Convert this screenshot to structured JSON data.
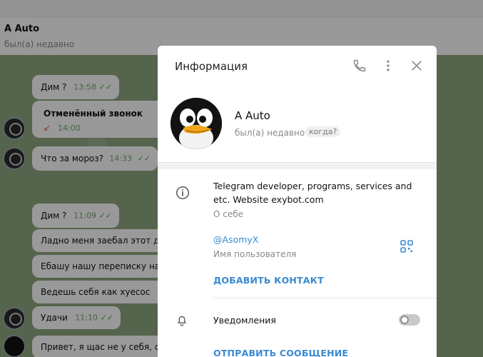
{
  "chat": {
    "title": "A Auto",
    "status": "был(а) недавно",
    "messages": [
      {
        "text": "Дим ?",
        "time": "13:58",
        "ticks": "✓✓"
      },
      {
        "text": "Отменённый звонок",
        "time": "14:00",
        "ticks": ""
      },
      {
        "text": "Что за мороз?",
        "time": "14:33",
        "ticks": "✓✓"
      },
      {
        "text": "Дим ?",
        "time": "11:09",
        "ticks": "✓✓"
      },
      {
        "text": "Ладно меня заебал этот др",
        "time": "",
        "ticks": ""
      },
      {
        "text": "Ебашу нашу переписку на",
        "time": "",
        "ticks": ""
      },
      {
        "text": "Ведешь себя как хуесос",
        "time": "",
        "ticks": ""
      },
      {
        "text": "Удачи",
        "time": "11:10",
        "ticks": "✓✓"
      },
      {
        "text": "Привет, я щас не у себя, св",
        "time": "",
        "ticks": ""
      }
    ]
  },
  "modal": {
    "title": "Информация",
    "icons": {
      "call": "phone-icon",
      "more": "more-vertical-icon",
      "close": "close-icon"
    },
    "profile": {
      "name": "A Auto",
      "status": "был(а) недавно",
      "when_chip": "когда?"
    },
    "bio": {
      "text": "Telegram developer, programs, services and etc. Website exybot.com",
      "label": "О себе"
    },
    "username": {
      "value": "@AsomyX",
      "label": "Имя пользователя"
    },
    "actions": {
      "add_contact": "ДОБАВИТЬ КОНТАКТ",
      "send_message": "ОТПРАВИТЬ СООБЩЕНИЕ"
    },
    "notifications": {
      "label": "Уведомления",
      "enabled": false
    }
  },
  "colors": {
    "accent": "#3a8ad1",
    "chat_bg": "#8ea77f",
    "tick": "#4fae4e",
    "missed_call": "#d9534f"
  }
}
